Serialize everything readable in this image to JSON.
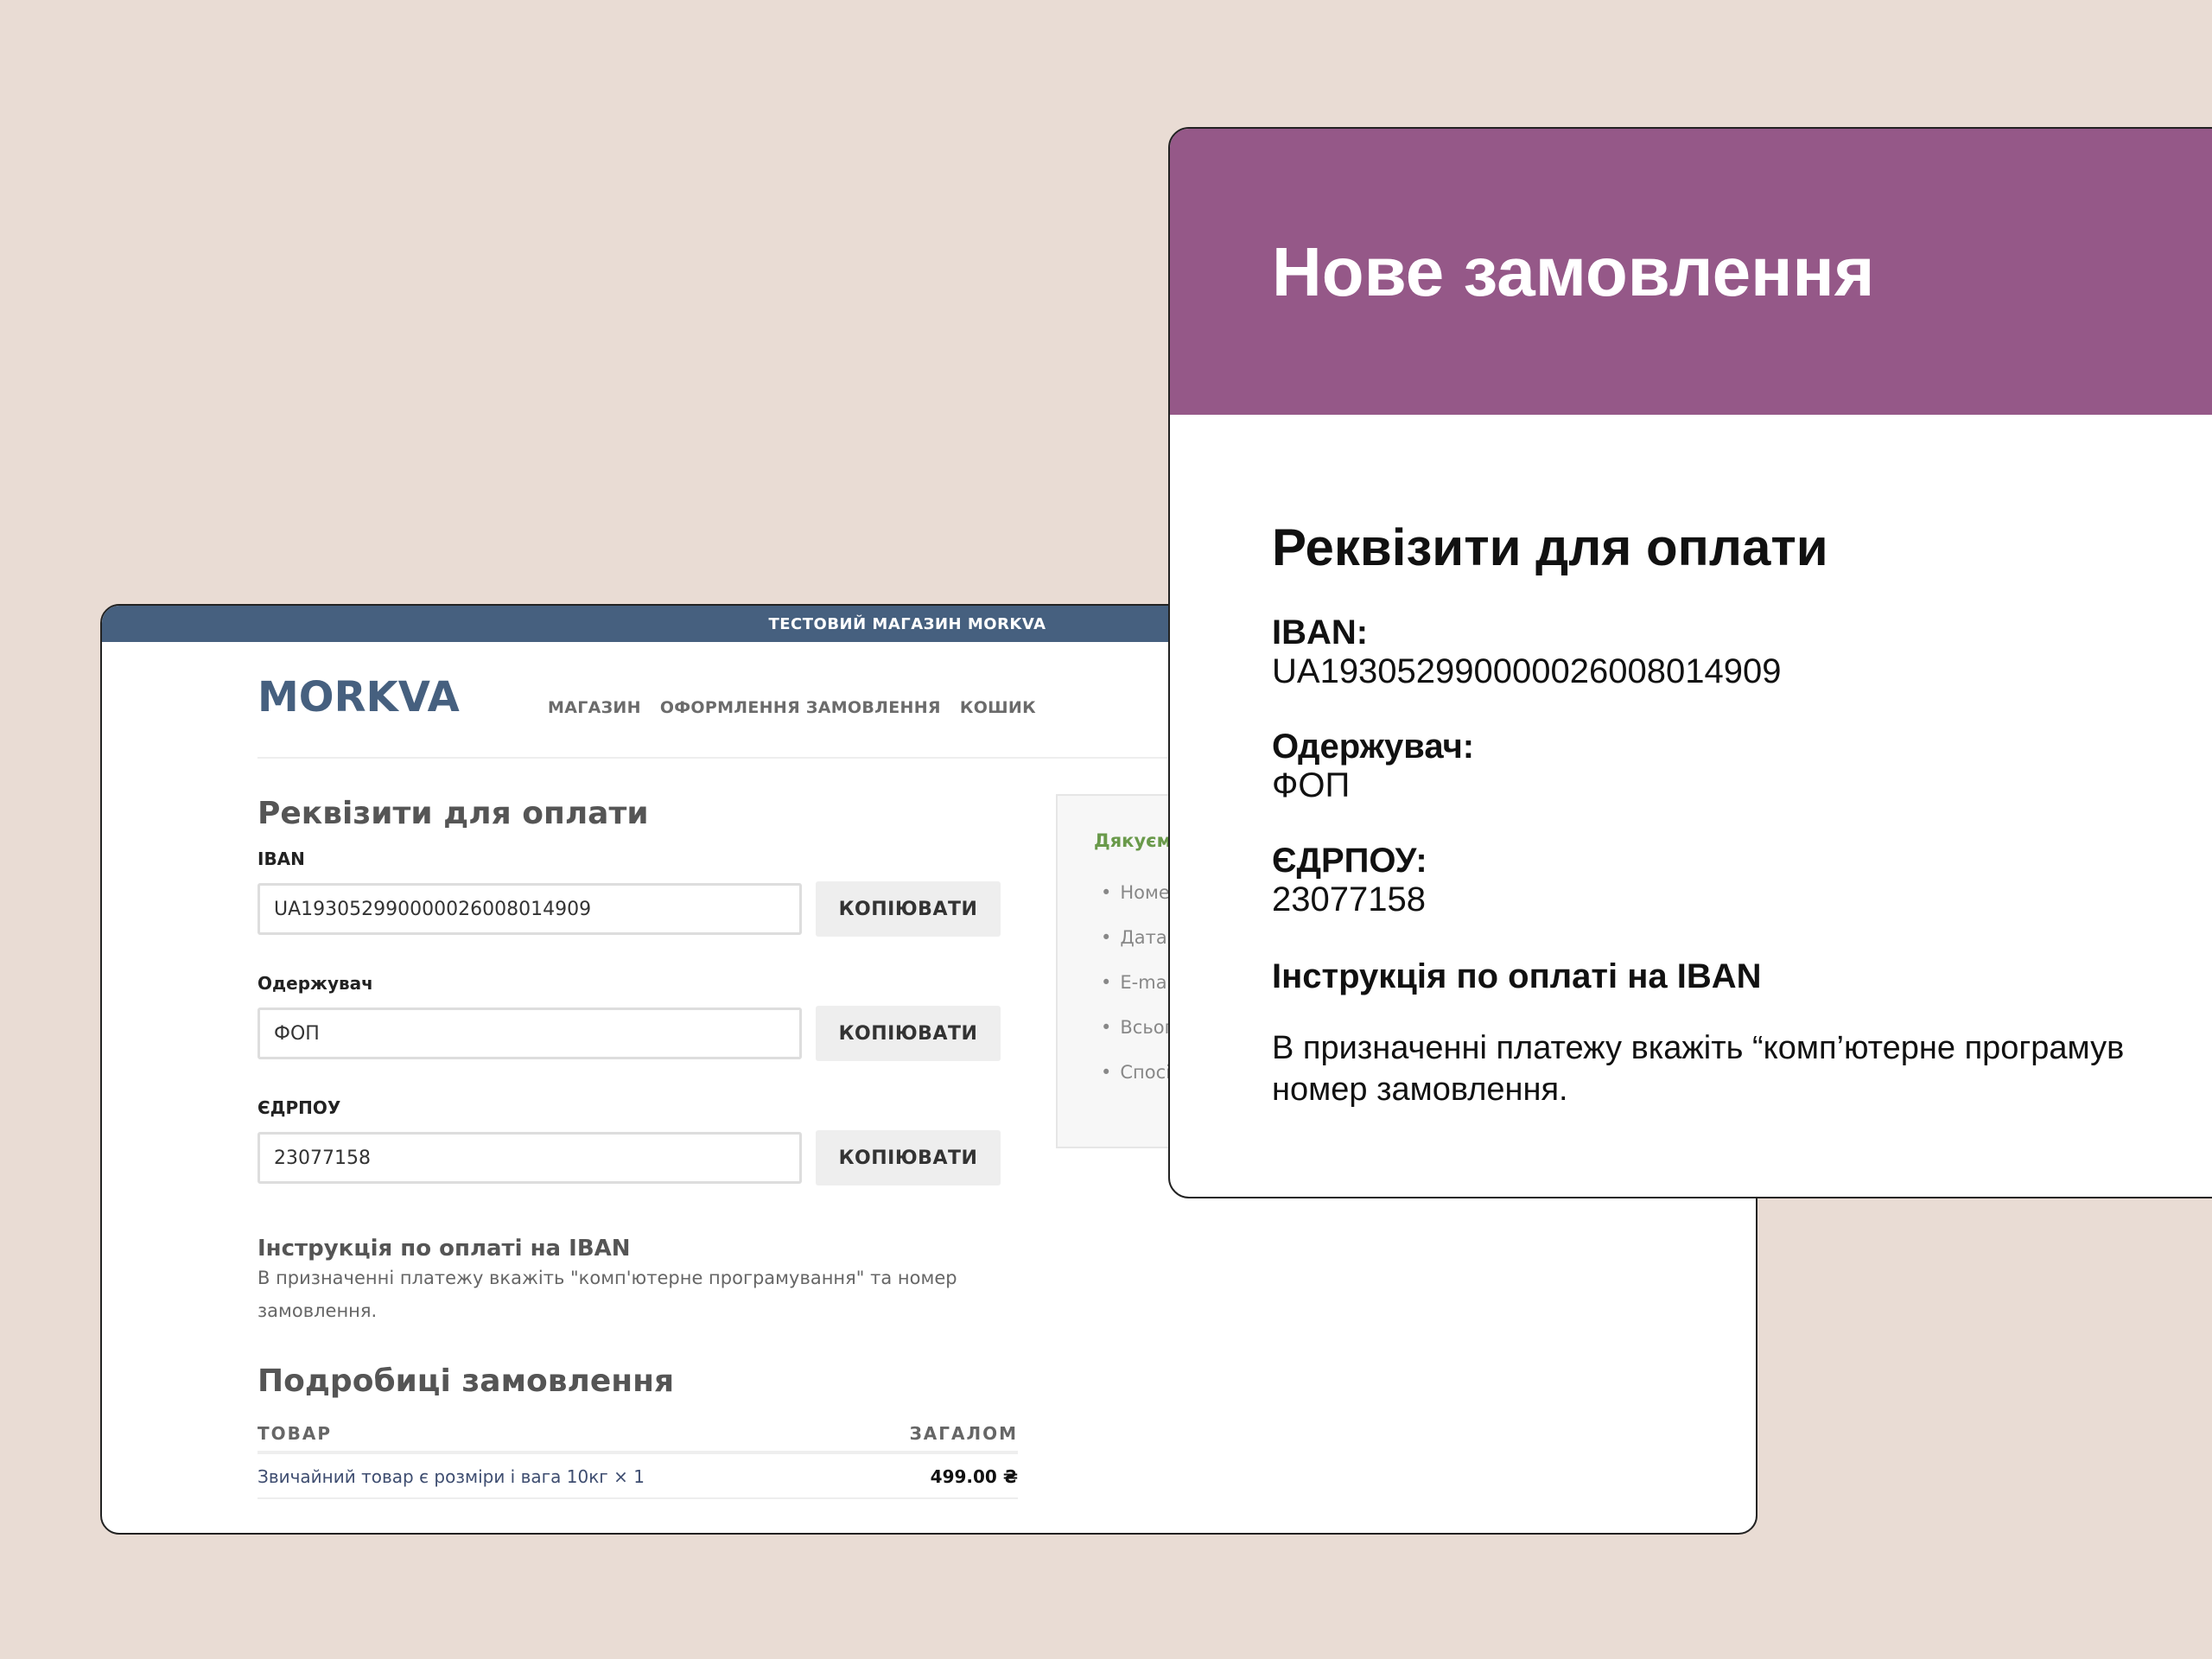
{
  "shop": {
    "topbar": "ТЕСТОВИЙ МАГАЗИН MORKVA",
    "logo": "MORKVA",
    "nav": [
      "МАГАЗИН",
      "ОФОРМЛЕННЯ ЗАМОВЛЕННЯ",
      "КОШИК"
    ],
    "payment_title": "Реквізити для оплати",
    "fields": [
      {
        "label": "IBAN",
        "value": "UA193052990000026008014909",
        "button": "КОПІЮВАТИ"
      },
      {
        "label": "Одержувач",
        "value": "ФОП",
        "button": "КОПІЮВАТИ"
      },
      {
        "label": "ЄДРПОУ",
        "value": "23077158",
        "button": "КОПІЮВАТИ"
      }
    ],
    "instruction_title": "Інструкція по оплаті на IBAN",
    "instruction_text": "В призначенні платежу вкажіть \"комп'ютерне програмування\" та номер замовлення.",
    "order_title": "Подробиці замовлення",
    "table": {
      "col_product": "ТОВАР",
      "col_total": "ЗАГАЛОМ",
      "rows": [
        {
          "product": "Звичайний товар є розміри і вага 10кг × 1",
          "total": "499.00 ₴"
        }
      ]
    },
    "side": {
      "title": "Дякуєм",
      "items": [
        "Номе",
        "Дата:",
        "E-mai",
        "Всьог",
        "Спосі"
      ]
    }
  },
  "email": {
    "header_title": "Нове замовлення",
    "payment_title": "Реквізити для оплати",
    "iban_label": "IBAN:",
    "iban_value": "UA193052990000026008014909",
    "recipient_label": "Одержувач:",
    "recipient_value": "ФОП",
    "edrpou_label": "ЄДРПОУ:",
    "edrpou_value": "23077158",
    "instruction_title": "Інструкція по оплаті на IBAN",
    "instruction_line1": "В призначенні платежу вкажіть “комп’ютерне програмув",
    "instruction_line2": "номер замовлення."
  },
  "colors": {
    "background": "#e9dcd4",
    "shop_brand": "#46607f",
    "email_header": "#955888",
    "side_title": "#6a9a4b"
  }
}
